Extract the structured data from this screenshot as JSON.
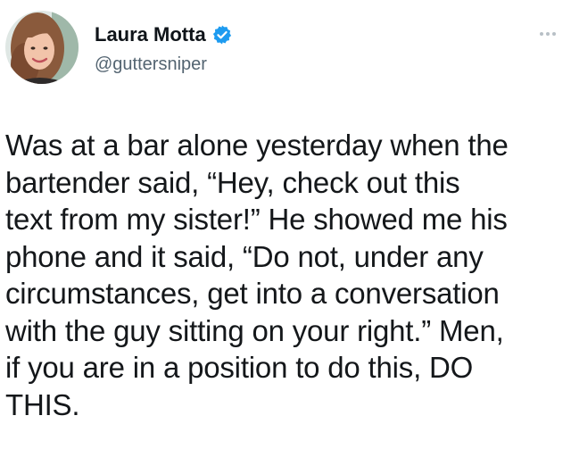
{
  "author": {
    "display_name": "Laura Motta",
    "handle": "@guttersniper",
    "verified": true,
    "verified_color": "#1d9bf0"
  },
  "tweet": {
    "text": "Was at a bar alone yesterday when the\nbartender said, “Hey, check out this\ntext from my sister!” He showed me his\nphone and it said, “Do not, under any\ncircumstances, get into a conversation\nwith the guy sitting on your right.” Men,\nif you are in a position to do this, DO\nTHIS."
  },
  "icons": {
    "verified": "verified-badge-icon",
    "more": "more-options-icon"
  }
}
